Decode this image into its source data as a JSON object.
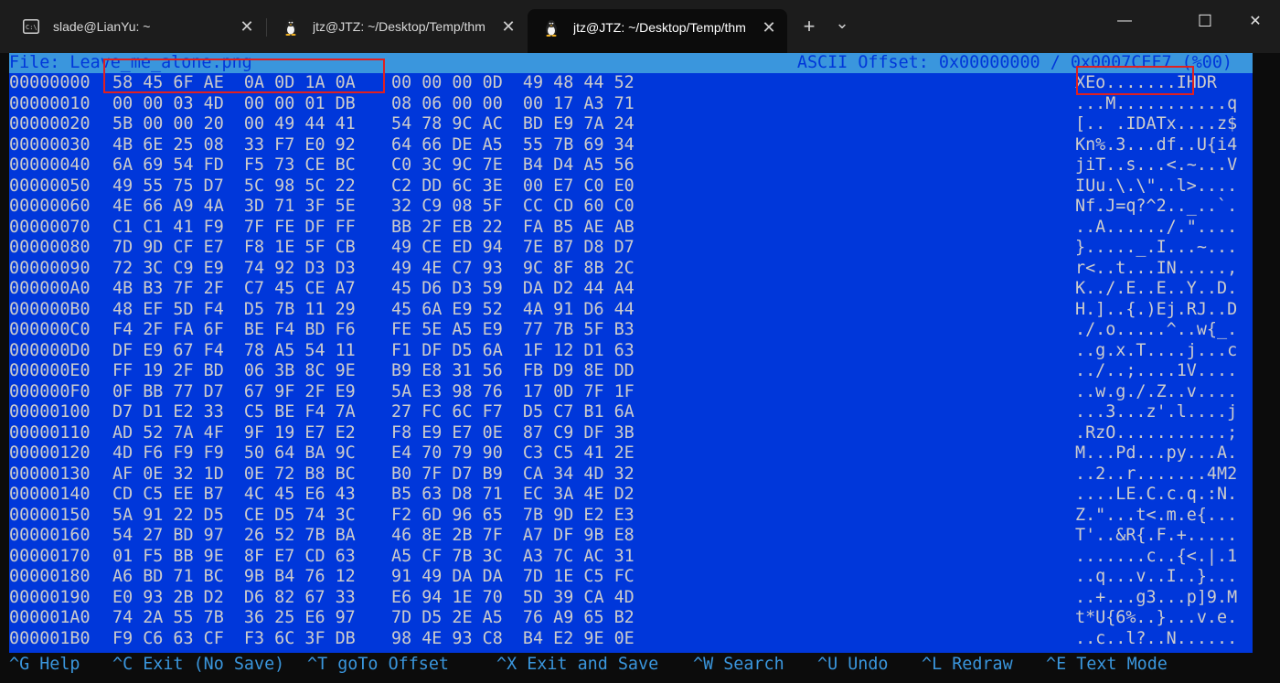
{
  "tabs": [
    {
      "label": "slade@LianYu: ~",
      "icon": "terminal-app-icon",
      "close": "✕"
    },
    {
      "label": "jtz@JTZ: ~/Desktop/Temp/thm",
      "icon": "linux-penguin-icon",
      "close": "✕"
    },
    {
      "label": "jtz@JTZ: ~/Desktop/Temp/thm",
      "icon": "linux-penguin-icon",
      "close": "✕"
    }
  ],
  "toolbar": {
    "new_tab": "+",
    "dropdown": "⌄"
  },
  "window": {
    "minimize": "—",
    "maximize": "☐",
    "close": "✕"
  },
  "hexedit": {
    "file_label": "File: Leave_me_alone.png",
    "offset_label": "ASCII Offset: 0x00000000 / 0x0007CEF7 (%00)",
    "rows": [
      {
        "off": "00000000",
        "g1": "58 45 6F AE  0A 0D 1A 0A",
        "g2": "00 00 00 0D  49 48 44 52",
        "ascii": "XEo.......IHDR"
      },
      {
        "off": "00000010",
        "g1": "00 00 03 4D  00 00 01 DB",
        "g2": "08 06 00 00  00 17 A3 71",
        "ascii": "...M...........q"
      },
      {
        "off": "00000020",
        "g1": "5B 00 00 20  00 49 44 41",
        "g2": "54 78 9C AC  BD E9 7A 24",
        "ascii": "[.. .IDATx....z$"
      },
      {
        "off": "00000030",
        "g1": "4B 6E 25 08  33 F7 E0 92",
        "g2": "64 66 DE A5  55 7B 69 34",
        "ascii": "Kn%.3...df..U{i4"
      },
      {
        "off": "00000040",
        "g1": "6A 69 54 FD  F5 73 CE BC",
        "g2": "C0 3C 9C 7E  B4 D4 A5 56",
        "ascii": "jiT..s...<.~...V"
      },
      {
        "off": "00000050",
        "g1": "49 55 75 D7  5C 98 5C 22",
        "g2": "C2 DD 6C 3E  00 E7 C0 E0",
        "ascii": "IUu.\\.\\\"..l>...."
      },
      {
        "off": "00000060",
        "g1": "4E 66 A9 4A  3D 71 3F 5E",
        "g2": "32 C9 08 5F  CC CD 60 C0",
        "ascii": "Nf.J=q?^2.._..`."
      },
      {
        "off": "00000070",
        "g1": "C1 C1 41 F9  7F FE DF FF",
        "g2": "BB 2F EB 22  FA B5 AE AB",
        "ascii": "..A....../.\"...."
      },
      {
        "off": "00000080",
        "g1": "7D 9D CF E7  F8 1E 5F CB",
        "g2": "49 CE ED 94  7E B7 D8 D7",
        "ascii": "}....._.I...~..."
      },
      {
        "off": "00000090",
        "g1": "72 3C C9 E9  74 92 D3 D3",
        "g2": "49 4E C7 93  9C 8F 8B 2C",
        "ascii": "r<..t...IN.....,"
      },
      {
        "off": "000000A0",
        "g1": "4B B3 7F 2F  C7 45 CE A7",
        "g2": "45 D6 D3 59  DA D2 44 A4",
        "ascii": "K../.E..E..Y..D."
      },
      {
        "off": "000000B0",
        "g1": "48 EF 5D F4  D5 7B 11 29",
        "g2": "45 6A E9 52  4A 91 D6 44",
        "ascii": "H.]..{.)Ej.RJ..D"
      },
      {
        "off": "000000C0",
        "g1": "F4 2F FA 6F  BE F4 BD F6",
        "g2": "FE 5E A5 E9  77 7B 5F B3",
        "ascii": "./.o.....^..w{_."
      },
      {
        "off": "000000D0",
        "g1": "DF E9 67 F4  78 A5 54 11",
        "g2": "F1 DF D5 6A  1F 12 D1 63",
        "ascii": "..g.x.T....j...c"
      },
      {
        "off": "000000E0",
        "g1": "FF 19 2F BD  06 3B 8C 9E",
        "g2": "B9 E8 31 56  FB D9 8E DD",
        "ascii": "../..;....1V...."
      },
      {
        "off": "000000F0",
        "g1": "0F BB 77 D7  67 9F 2F E9",
        "g2": "5A E3 98 76  17 0D 7F 1F",
        "ascii": "..w.g./.Z..v...."
      },
      {
        "off": "00000100",
        "g1": "D7 D1 E2 33  C5 BE F4 7A",
        "g2": "27 FC 6C F7  D5 C7 B1 6A",
        "ascii": "...3...z'.l....j"
      },
      {
        "off": "00000110",
        "g1": "AD 52 7A 4F  9F 19 E7 E2",
        "g2": "F8 E9 E7 0E  87 C9 DF 3B",
        "ascii": ".RzO...........;"
      },
      {
        "off": "00000120",
        "g1": "4D F6 F9 F9  50 64 BA 9C",
        "g2": "E4 70 79 90  C3 C5 41 2E",
        "ascii": "M...Pd...py...A."
      },
      {
        "off": "00000130",
        "g1": "AF 0E 32 1D  0E 72 B8 BC",
        "g2": "B0 7F D7 B9  CA 34 4D 32",
        "ascii": "..2..r.......4M2"
      },
      {
        "off": "00000140",
        "g1": "CD C5 EE B7  4C 45 E6 43",
        "g2": "B5 63 D8 71  EC 3A 4E D2",
        "ascii": "....LE.C.c.q.:N."
      },
      {
        "off": "00000150",
        "g1": "5A 91 22 D5  CE D5 74 3C",
        "g2": "F2 6D 96 65  7B 9D E2 E3",
        "ascii": "Z.\"...t<.m.e{..."
      },
      {
        "off": "00000160",
        "g1": "54 27 BD 97  26 52 7B BA",
        "g2": "46 8E 2B 7F  A7 DF 9B E8",
        "ascii": "T'..&R{.F.+....."
      },
      {
        "off": "00000170",
        "g1": "01 F5 BB 9E  8F E7 CD 63",
        "g2": "A5 CF 7B 3C  A3 7C AC 31",
        "ascii": ".......c..{<.|.1"
      },
      {
        "off": "00000180",
        "g1": "A6 BD 71 BC  9B B4 76 12",
        "g2": "91 49 DA DA  7D 1E C5 FC",
        "ascii": "..q...v..I..}..."
      },
      {
        "off": "00000190",
        "g1": "E0 93 2B D2  D6 82 67 33",
        "g2": "E6 94 1E 70  5D 39 CA 4D",
        "ascii": "..+...g3...p]9.M"
      },
      {
        "off": "000001A0",
        "g1": "74 2A 55 7B  36 25 E6 97",
        "g2": "7D D5 2E A5  76 A9 65 B2",
        "ascii": "t*U{6%..}...v.e."
      },
      {
        "off": "000001B0",
        "g1": "F9 C6 63 CF  F3 6C 3F DB",
        "g2": "98 4E 93 C8  B4 E2 9E 0E",
        "ascii": "..c..l?..N......"
      }
    ],
    "shortcuts": [
      "^G Help",
      "^C Exit (No Save)",
      "^T goTo Offset",
      "^X Exit and Save",
      "^W Search",
      "^U Undo",
      "^L Redraw",
      "^E Text Mode"
    ]
  },
  "colors": {
    "background": "#0037da",
    "text": "#cccccc",
    "status_bar": "#3a96dd",
    "highlight_box": "#e02020"
  }
}
